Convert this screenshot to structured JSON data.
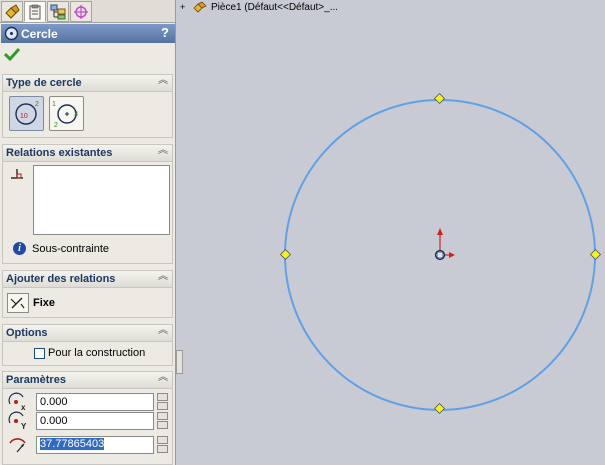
{
  "window": {
    "title": "Cercle",
    "help": "?"
  },
  "tabs": [
    {
      "name": "feature-manager",
      "icon": "feature-tree-icon"
    },
    {
      "name": "property-manager",
      "icon": "property-sheet-icon"
    },
    {
      "name": "configuration-manager",
      "icon": "configuration-icon"
    },
    {
      "name": "dim-xpert",
      "icon": "crosshair-target-icon"
    }
  ],
  "sections": {
    "circle_type": {
      "title": "Type de cercle",
      "option_center": "10",
      "option_perimeter": "3"
    },
    "existing_relations": {
      "title": "Relations existantes",
      "status": "Sous-contrainte"
    },
    "add_relations": {
      "title": "Ajouter des relations",
      "fix_label": "Fixe"
    },
    "options": {
      "title": "Options",
      "construction_label": "Pour la construction",
      "construction_checked": false
    },
    "parameters": {
      "title": "Paramètres",
      "center_x": "0.000",
      "center_y": "0.000",
      "radius": "37.77865403"
    }
  },
  "tree": {
    "expand": "+",
    "part_label": "Pièce1  (Défaut<<Défaut>_..."
  },
  "colors": {
    "circle": "#5fa0e6",
    "point": "#f7f317",
    "header": "#6b87b9",
    "accept": "#2f9a2c"
  }
}
